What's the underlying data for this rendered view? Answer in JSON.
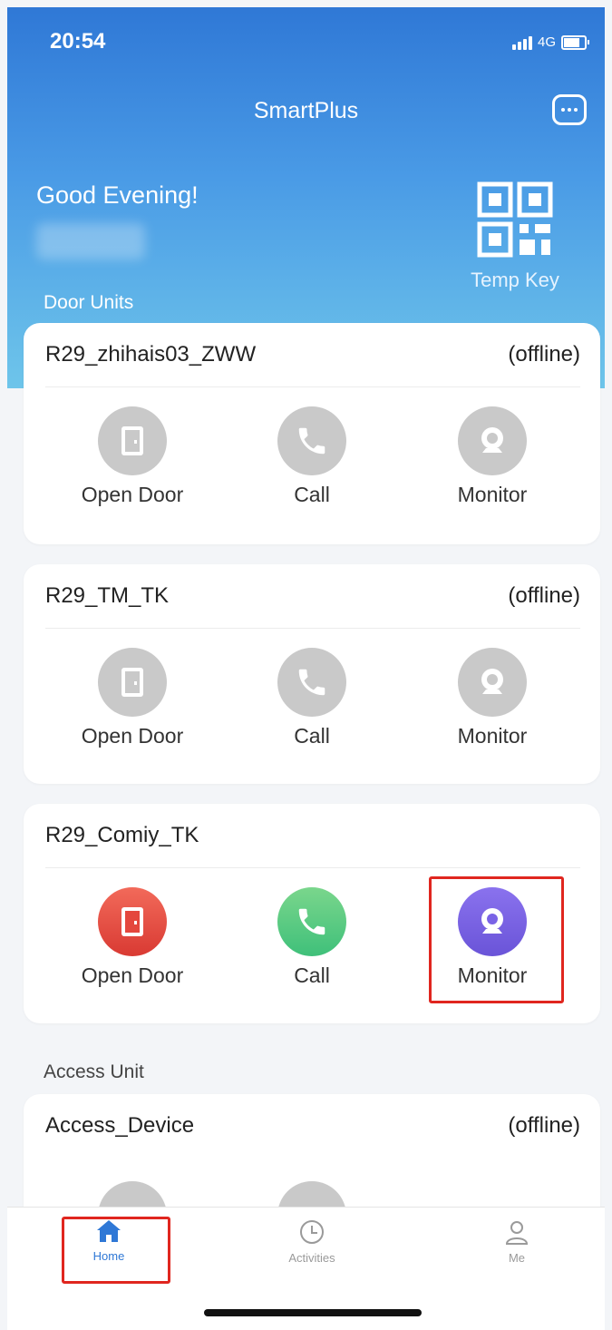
{
  "status_bar": {
    "time": "20:54",
    "network": "4G"
  },
  "header": {
    "title": "SmartPlus",
    "greeting": "Good Evening!",
    "temp_key_label": "Temp Key"
  },
  "sections": {
    "door_units_label": "Door Units",
    "access_unit_label": "Access Unit"
  },
  "door_units": [
    {
      "name": "R29_zhihais03_ZWW",
      "status": "(offline)",
      "actions": {
        "open_door": "Open Door",
        "call": "Call",
        "monitor": "Monitor"
      }
    },
    {
      "name": "R29_TM_TK",
      "status": "(offline)",
      "actions": {
        "open_door": "Open Door",
        "call": "Call",
        "monitor": "Monitor"
      }
    },
    {
      "name": "R29_Comiy_TK",
      "status": "",
      "actions": {
        "open_door": "Open Door",
        "call": "Call",
        "monitor": "Monitor"
      }
    }
  ],
  "access_units": [
    {
      "name": "Access_Device",
      "status": "(offline)"
    }
  ],
  "tabbar": {
    "home": "Home",
    "activities": "Activities",
    "me": "Me"
  },
  "colors": {
    "accent": "#2f78d6",
    "open_door": "#e4473d",
    "call": "#55c983",
    "monitor": "#7a63e6",
    "highlight": "#e0261f"
  }
}
